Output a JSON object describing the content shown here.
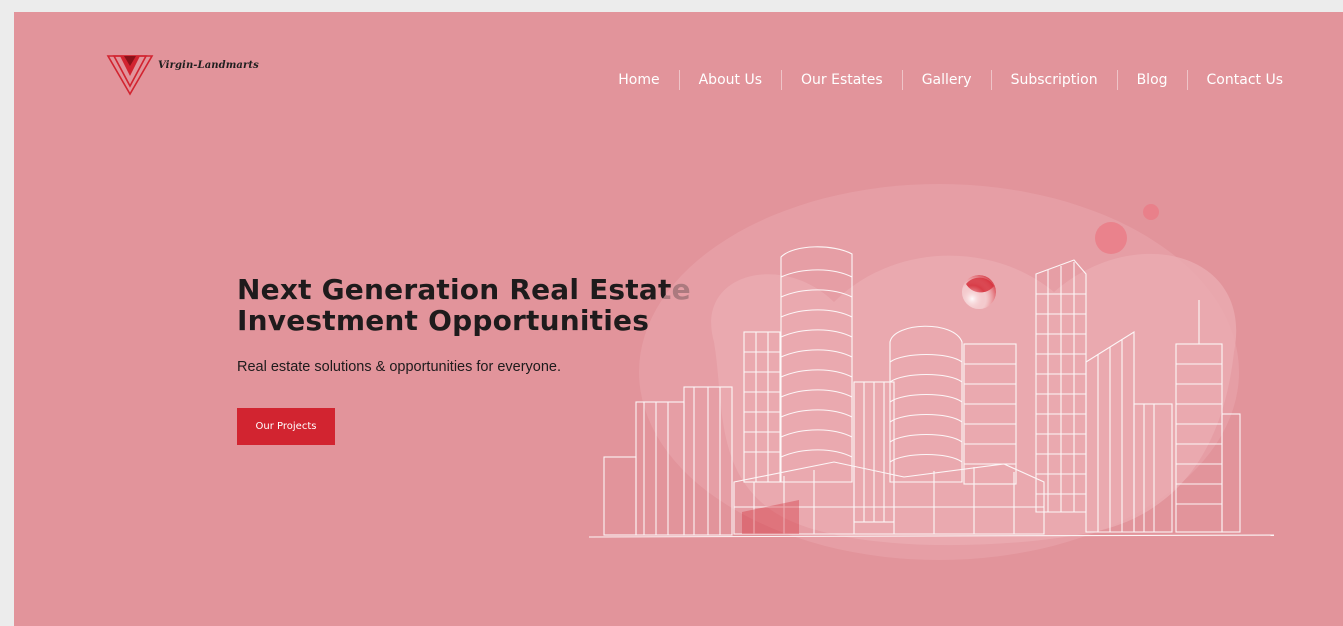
{
  "brand": {
    "name": "Virgin-Landmarts",
    "accent": "#d22430",
    "background": "#e2949b"
  },
  "nav": {
    "items": [
      {
        "label": "Home"
      },
      {
        "label": "About Us"
      },
      {
        "label": "Our Estates"
      },
      {
        "label": "Gallery"
      },
      {
        "label": "Subscription"
      },
      {
        "label": "Blog"
      },
      {
        "label": "Contact Us"
      }
    ]
  },
  "hero": {
    "title_line1": "Next Generation Real Estate",
    "title_line2": "Investment Opportunities",
    "subtitle": "Real estate solutions & opportunities for everyone.",
    "cta_label": "Our Projects",
    "illustration": "city-skyline-sketch"
  }
}
